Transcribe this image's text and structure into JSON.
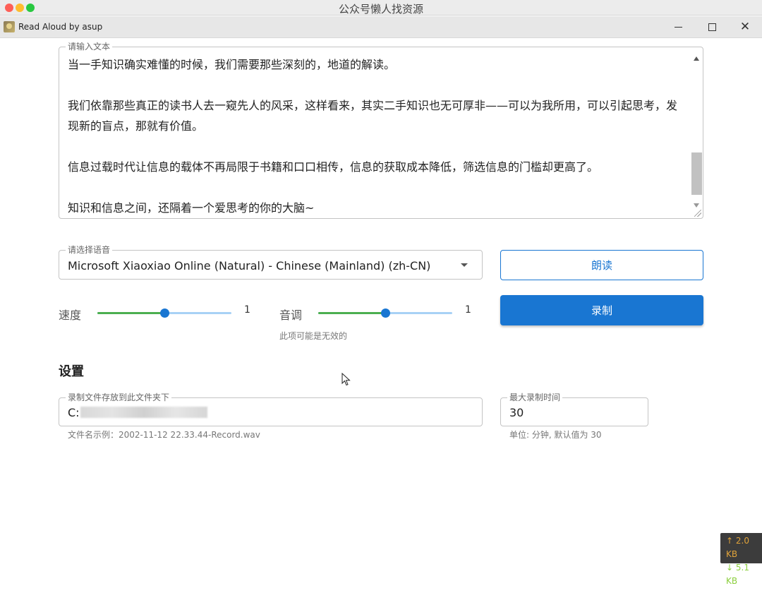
{
  "mac_window": {
    "title": "公众号懒人找资源"
  },
  "app": {
    "title": "Read Aloud by asup",
    "controls": {
      "minimize": "minimize",
      "maximize": "maximize",
      "close": "close"
    }
  },
  "text_input": {
    "legend": "请输入文本",
    "paragraphs": [
      "当一手知识确实难懂的时候，我们需要那些深刻的，地道的解读。",
      "我们依靠那些真正的读书人去一窥先人的风采，这样看来，其实二手知识也无可厚非——可以为我所用，可以引起思考，发现新的盲点，那就有价值。",
      "信息过载时代让信息的载体不再局限于书籍和口口相传，信息的获取成本降低，筛选信息的门槛却更高了。",
      "知识和信息之间，还隔着一个爱思考的你的大脑~"
    ]
  },
  "voice_select": {
    "legend": "请选择语音",
    "value": "Microsoft Xiaoxiao Online (Natural) - Chinese (Mainland) (zh-CN)"
  },
  "buttons": {
    "read": "朗读",
    "record": "录制"
  },
  "speed": {
    "label": "速度",
    "value_text": "1",
    "level": 0.5
  },
  "pitch": {
    "label": "音调",
    "value_text": "1",
    "level": 0.5,
    "hint": "此项可能是无效的"
  },
  "settings": {
    "title": "设置",
    "folder": {
      "legend": "录制文件存放到此文件夹下",
      "value": "C:",
      "helper": "文件名示例：2002-11-12 22.33.44-Record.wav"
    },
    "max_time": {
      "legend": "最大录制时间",
      "value": "30",
      "helper": "单位: 分钟, 默认值为 30"
    }
  },
  "network": {
    "up": "↑ 2.0 KB",
    "down": "↓ 5.1 KB"
  },
  "colors": {
    "primary": "#1976d2",
    "slider_fill": "#4caf50",
    "slider_track": "#a8d1f5"
  }
}
